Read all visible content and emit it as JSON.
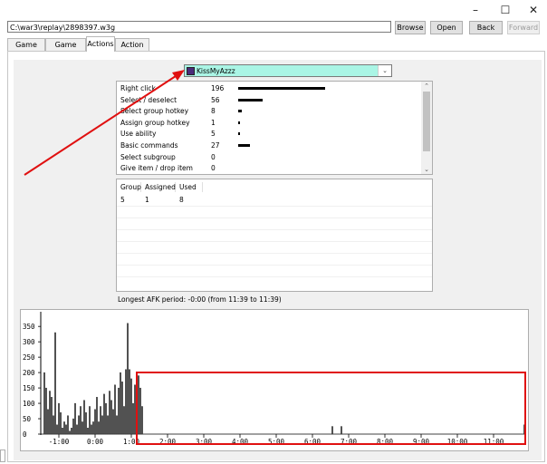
{
  "window": {
    "minimize_label": "–",
    "maximize_label": "☐",
    "close_label": "✕"
  },
  "toolbar": {
    "path_value": "C:\\war3\\replay\\2898397.w3g",
    "browse_label": "Browse",
    "open_label": "Open",
    "back_label": "Back",
    "forward_label": "Forward"
  },
  "tabs": [
    {
      "label": "Game Info",
      "active": false
    },
    {
      "label": "Game Chat",
      "active": false
    },
    {
      "label": "Actions",
      "active": true
    },
    {
      "label": "Action Log",
      "active": false
    }
  ],
  "player_select": {
    "value": "KissMyAzzz",
    "bg_color": "#aaf5e5"
  },
  "actions": [
    {
      "name": "Right click",
      "count": "196",
      "value": 196
    },
    {
      "name": "Select / deselect",
      "count": "56",
      "value": 56
    },
    {
      "name": "Select group hotkey",
      "count": "8",
      "value": 8
    },
    {
      "name": "Assign group hotkey",
      "count": "1",
      "value": 1
    },
    {
      "name": "Use ability",
      "count": "5",
      "value": 5
    },
    {
      "name": "Basic commands",
      "count": "27",
      "value": 27
    },
    {
      "name": "Select subgroup",
      "count": "0",
      "value": 0
    },
    {
      "name": "Give item / drop item",
      "count": "0",
      "value": 0
    }
  ],
  "groups": {
    "headers": [
      "Group",
      "Assigned",
      "Used"
    ],
    "rows": [
      [
        "5",
        "1",
        "8"
      ]
    ]
  },
  "afk_text": "Longest AFK period: -0:00 (from 11:39 to 11:39)",
  "chart_data": {
    "type": "bar",
    "y_ticks": [
      "350",
      "300",
      "250",
      "200",
      "150",
      "100",
      "50",
      "0"
    ],
    "x_ticks": [
      "-1:00",
      "0:00",
      "1:00",
      "2:00",
      "3:00",
      "4:00",
      "5:00",
      "6:00",
      "7:00",
      "8:00",
      "9:00",
      "10:00",
      "11:00"
    ],
    "ylim": [
      0,
      380
    ],
    "xlim": [
      -1.5,
      11.9
    ],
    "x_minutes": [
      -1.4,
      -1.35,
      -1.3,
      -1.25,
      -1.2,
      -1.15,
      -1.1,
      -1.05,
      -1.0,
      -0.95,
      -0.9,
      -0.85,
      -0.8,
      -0.75,
      -0.7,
      -0.65,
      -0.6,
      -0.55,
      -0.5,
      -0.45,
      -0.4,
      -0.35,
      -0.3,
      -0.25,
      -0.2,
      -0.15,
      -0.1,
      -0.05,
      0.0,
      0.05,
      0.1,
      0.15,
      0.2,
      0.25,
      0.3,
      0.35,
      0.4,
      0.45,
      0.5,
      0.55,
      0.6,
      0.65,
      0.7,
      0.75,
      0.8,
      0.85,
      0.9,
      0.95,
      1.0,
      1.05,
      1.1,
      1.15,
      1.2,
      1.25,
      1.3,
      6.55,
      6.8,
      11.85
    ],
    "values": [
      200,
      150,
      80,
      140,
      120,
      60,
      330,
      30,
      100,
      70,
      20,
      40,
      30,
      60,
      10,
      20,
      50,
      100,
      30,
      60,
      90,
      40,
      110,
      70,
      20,
      90,
      30,
      40,
      80,
      120,
      40,
      90,
      60,
      130,
      100,
      60,
      140,
      110,
      80,
      160,
      60,
      150,
      200,
      170,
      90,
      210,
      360,
      210,
      180,
      100,
      160,
      120,
      190,
      150,
      90,
      25,
      25,
      30
    ]
  }
}
